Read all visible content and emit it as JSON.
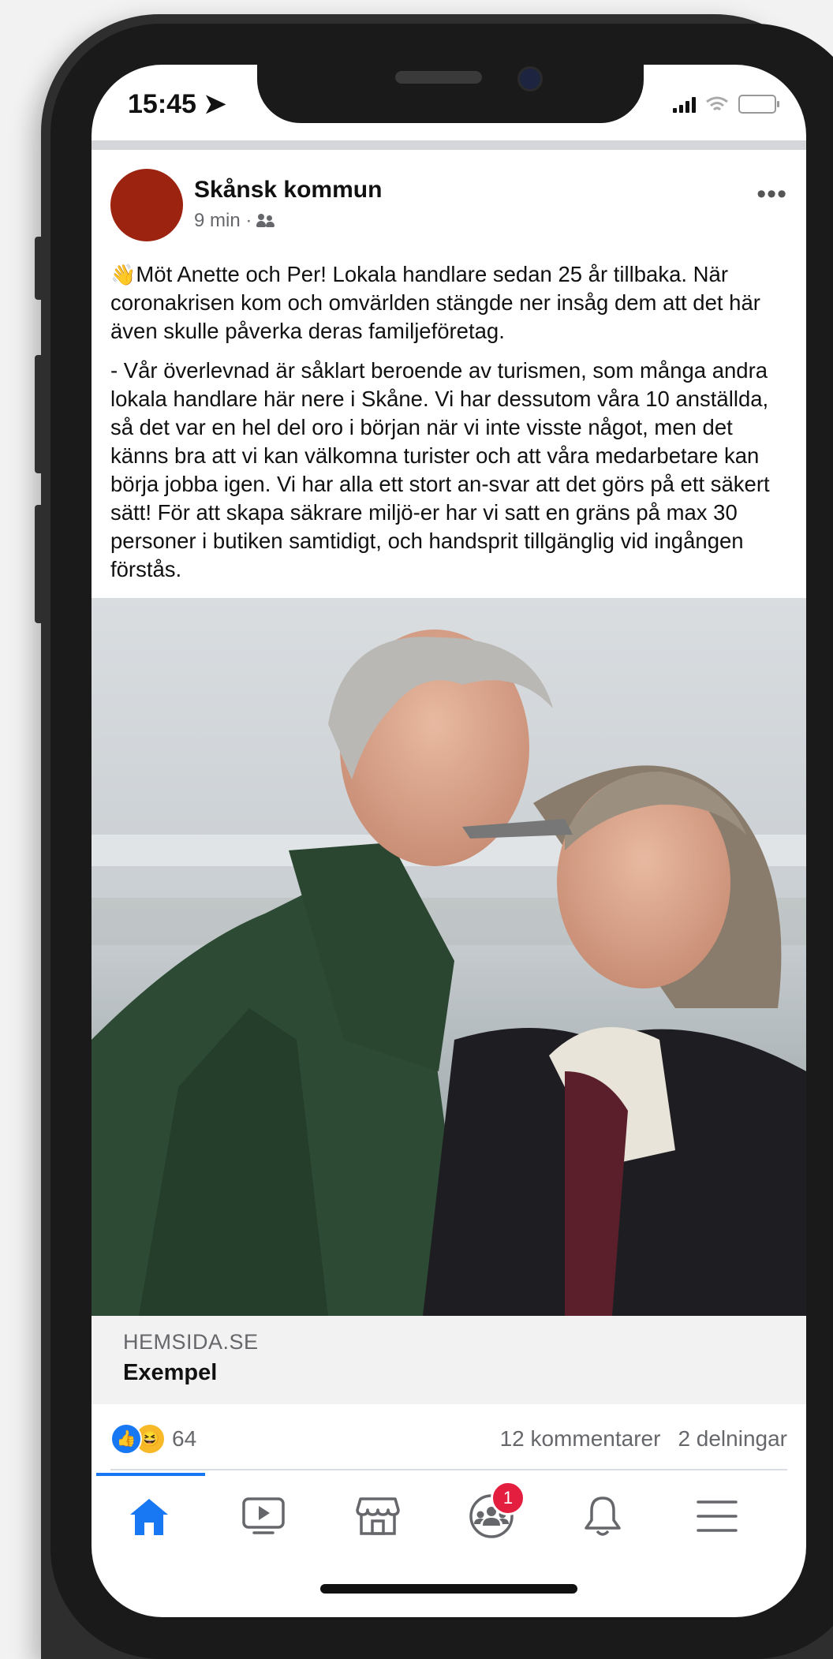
{
  "status_bar": {
    "time": "15:45 ➤"
  },
  "post": {
    "author": "Skånsk kommun",
    "time": "9 min ·",
    "audience_icon": "friends-icon",
    "more_icon": "•••",
    "paragraph1": "Möt Anette och Per! Lokala handlare sedan 25 år tillbaka. När coronakrisen kom och omvärlden stängde ner insåg dem att det här även skulle påverka deras familjeföretag.",
    "paragraph1_emoji": "👋",
    "paragraph2": "- Vår överlevnad är såklart beroende av turismen, som många andra lokala handlare här nere i Skåne. Vi har dessutom våra 10 anställda, så det  var en hel del oro i början när vi inte visste något, men det känns bra att vi kan välkomna turister och att våra medarbetare kan börja jobba igen. Vi har alla ett stort an-svar att det görs på ett säkert sätt! För att skapa säkrare miljö-er har vi satt en gräns på max 30 personer i butiken samtidigt, och handsprit tillgänglig vid ingången förstås.",
    "link": {
      "domain": "HEMSIDA.SE",
      "title": "Exempel"
    },
    "reactions": {
      "count": "64",
      "comments": "12 kommentarer",
      "shares": "2 delningar"
    }
  },
  "tabbar": {
    "tabs": [
      {
        "name": "home",
        "icon": "home-icon",
        "active": true
      },
      {
        "name": "watch",
        "icon": "video-icon"
      },
      {
        "name": "marketplace",
        "icon": "store-icon"
      },
      {
        "name": "groups",
        "icon": "groups-icon",
        "badge": "1"
      },
      {
        "name": "notifications",
        "icon": "bell-icon"
      },
      {
        "name": "menu",
        "icon": "menu-icon"
      }
    ]
  },
  "colors": {
    "accent": "#1877f2",
    "avatar": "#9c2310",
    "badge": "#e41e3f"
  }
}
